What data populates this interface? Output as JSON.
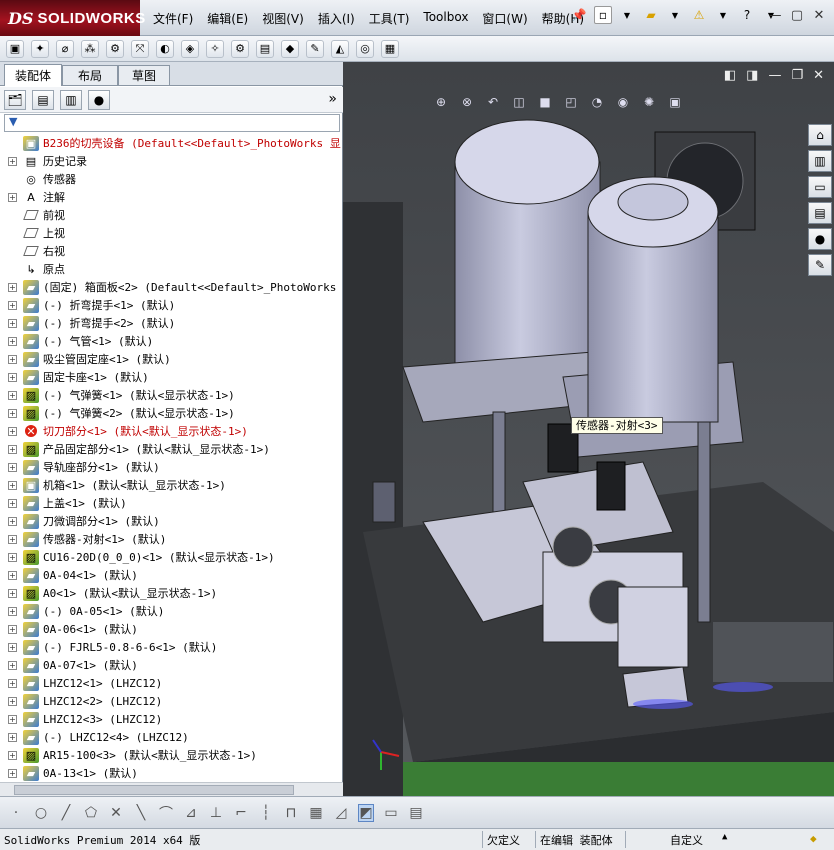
{
  "app": {
    "logo_ds": "DS",
    "logo_name": "SOLIDWORKS"
  },
  "menu": [
    "文件(F)",
    "编辑(E)",
    "视图(V)",
    "插入(I)",
    "工具(T)",
    "Toolbox",
    "窗口(W)",
    "帮助(H)"
  ],
  "panel": {
    "tabs": [
      "装配体",
      "布局",
      "草图"
    ],
    "expand_glyph": "»"
  },
  "tree": [
    {
      "label": "B236的切壳设备  (Default<<Default>_PhotoWorks 显",
      "icon": "assembly-root-icon",
      "red": true,
      "expander": false
    },
    {
      "label": "历史记录",
      "icon": "history-icon",
      "red": false,
      "expander": true
    },
    {
      "label": "传感器",
      "icon": "sensor-icon",
      "red": false,
      "expander": false
    },
    {
      "label": "注解",
      "icon": "annotation-icon",
      "red": false,
      "expander": true
    },
    {
      "label": "前视",
      "icon": "plane-icon",
      "red": false,
      "expander": false
    },
    {
      "label": "上视",
      "icon": "plane-icon",
      "red": false,
      "expander": false
    },
    {
      "label": "右视",
      "icon": "plane-icon",
      "red": false,
      "expander": false
    },
    {
      "label": "原点",
      "icon": "origin-icon",
      "red": false,
      "expander": false
    },
    {
      "label": "(固定) 箱面板<2> (Default<<Default>_PhotoWorks",
      "icon": "part-icon",
      "red": false,
      "expander": true
    },
    {
      "label": "(-) 折弯提手<1> (默认)",
      "icon": "part-icon",
      "red": false,
      "expander": true
    },
    {
      "label": "(-) 折弯提手<2> (默认)",
      "icon": "part-icon",
      "red": false,
      "expander": true
    },
    {
      "label": "(-) 气管<1> (默认)",
      "icon": "part-icon",
      "red": false,
      "expander": true
    },
    {
      "label": "吸尘管固定座<1> (默认)",
      "icon": "part-icon",
      "red": false,
      "expander": true
    },
    {
      "label": "固定卡座<1> (默认)",
      "icon": "part-icon",
      "red": false,
      "expander": true
    },
    {
      "label": "(-) 气弹簧<1> (默认<显示状态-1>)",
      "icon": "subassembly-icon",
      "red": false,
      "expander": true
    },
    {
      "label": "(-) 气弹簧<2> (默认<显示状态-1>)",
      "icon": "subassembly-icon",
      "red": false,
      "expander": true
    },
    {
      "label": "切刀部分<1> (默认<默认_显示状态-1>)",
      "icon": "error-icon",
      "red": true,
      "expander": true
    },
    {
      "label": "产品固定部分<1> (默认<默认_显示状态-1>)",
      "icon": "subassembly-icon",
      "red": false,
      "expander": true
    },
    {
      "label": "导轨座部分<1> (默认)",
      "icon": "part-icon",
      "red": false,
      "expander": true
    },
    {
      "label": "机箱<1> (默认<默认_显示状态-1>)",
      "icon": "assembly-icon",
      "red": false,
      "expander": true
    },
    {
      "label": "上盖<1> (默认)",
      "icon": "part-icon",
      "red": false,
      "expander": true
    },
    {
      "label": "刀微调部分<1> (默认)",
      "icon": "part-icon",
      "red": false,
      "expander": true
    },
    {
      "label": "传感器-对射<1> (默认)",
      "icon": "part-icon",
      "red": false,
      "expander": true
    },
    {
      "label": "CU16-20D(0_0_0)<1> (默认<显示状态-1>)",
      "icon": "subassembly-icon",
      "red": false,
      "expander": true
    },
    {
      "label": "0A-04<1> (默认)",
      "icon": "part-icon",
      "red": false,
      "expander": true
    },
    {
      "label": "A0<1> (默认<默认_显示状态-1>)",
      "icon": "subassembly-icon",
      "red": false,
      "expander": true
    },
    {
      "label": "(-) 0A-05<1> (默认)",
      "icon": "part-icon",
      "red": false,
      "expander": true
    },
    {
      "label": "0A-06<1> (默认)",
      "icon": "part-icon",
      "red": false,
      "expander": true
    },
    {
      "label": "(-) FJRL5-0.8-6-6<1> (默认)",
      "icon": "part-icon",
      "red": false,
      "expander": true
    },
    {
      "label": "0A-07<1> (默认)",
      "icon": "part-icon",
      "red": false,
      "expander": true
    },
    {
      "label": "LHZC12<1> (LHZC12)",
      "icon": "part-icon",
      "red": false,
      "expander": true
    },
    {
      "label": "LHZC12<2> (LHZC12)",
      "icon": "part-icon",
      "red": false,
      "expander": true
    },
    {
      "label": "LHZC12<3> (LHZC12)",
      "icon": "part-icon",
      "red": false,
      "expander": true
    },
    {
      "label": "(-) LHZC12<4> (LHZC12)",
      "icon": "part-icon",
      "red": false,
      "expander": true
    },
    {
      "label": "AR15-100<3> (默认<默认_显示状态-1>)",
      "icon": "subassembly-icon",
      "red": false,
      "expander": true
    },
    {
      "label": "0A-13<1> (默认)",
      "icon": "part-icon",
      "red": false,
      "expander": true
    }
  ],
  "viewport": {
    "tooltip": "传感器-对射<3>"
  },
  "status": {
    "product": "SolidWorks Premium 2014 x64 版",
    "underdefined": "欠定义",
    "editing": "在编辑 装配体",
    "custom": "自定义"
  },
  "colors": {
    "brand": "#a3121f",
    "error_text": "#c00000",
    "viewport_bg": "#4b4e52"
  }
}
